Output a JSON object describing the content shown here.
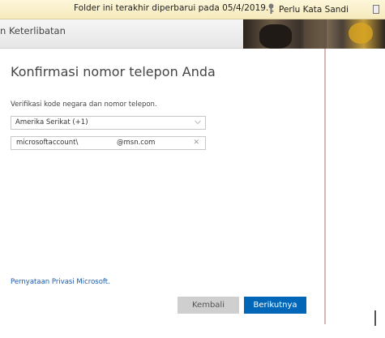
{
  "notification": {
    "message": "Folder ini terakhir diperbarui pada 05/4/2019.",
    "password_label": "Perlu Kata Sandi"
  },
  "header": {
    "title": "n Keterlibatan"
  },
  "dialog": {
    "title": "Konfirmasi nomor telepon Anda",
    "instruction": "Verifikasi kode negara dan nomor telepon.",
    "country_select": {
      "value": "Amerika Serikat (+1)"
    },
    "phone_field": {
      "value_prefix": "microsoftaccount\\",
      "value_suffix": "@msn.com",
      "clear_symbol": "✕"
    },
    "privacy_link": "Pernyataan Privasi Microsoft.",
    "buttons": {
      "back": "Kembali",
      "next": "Berikutnya"
    }
  },
  "colors": {
    "accent": "#0067b8",
    "link": "#1a5aa8",
    "notification_bg": "#f6ebbd"
  }
}
